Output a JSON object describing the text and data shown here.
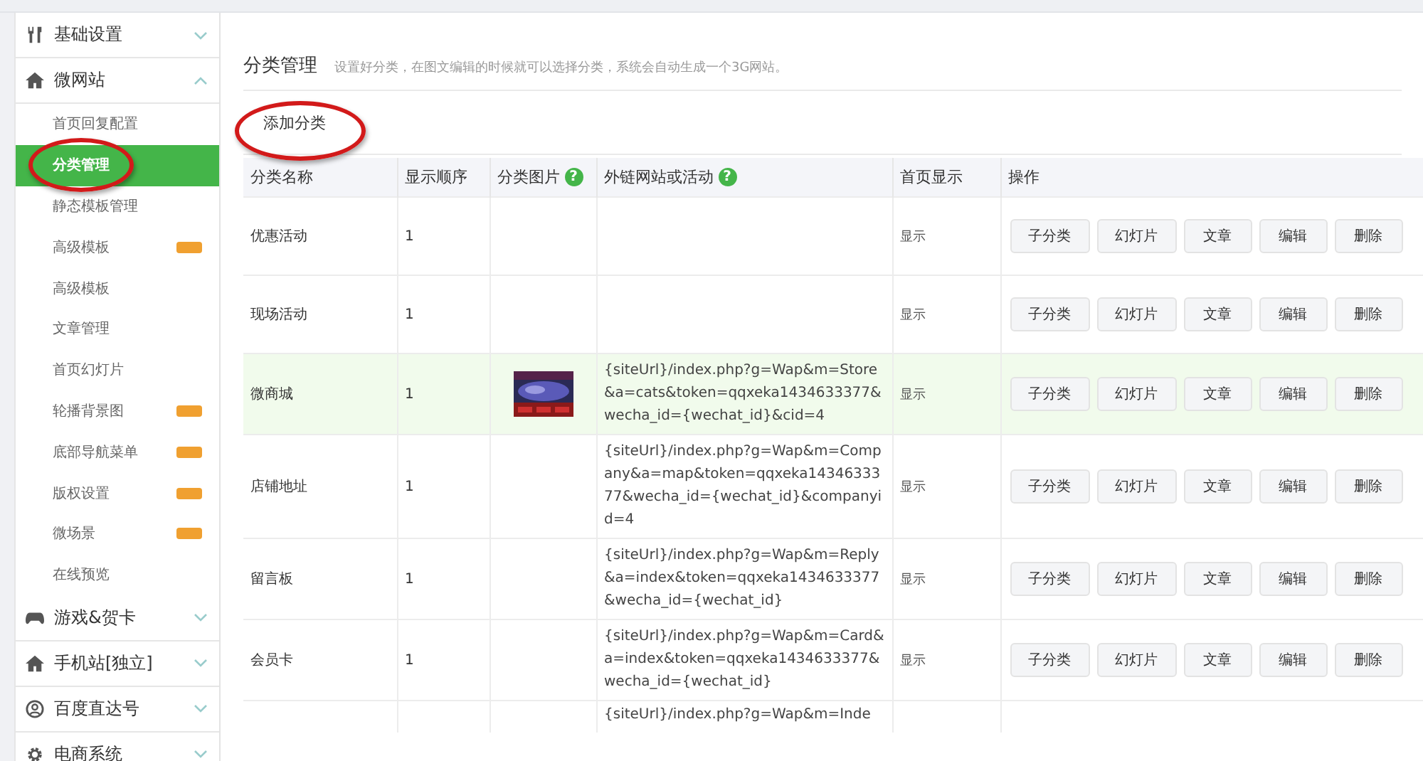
{
  "sidebar": {
    "groups": [
      {
        "label": "基础设置",
        "expanded": false
      },
      {
        "label": "微网站",
        "expanded": true,
        "items": [
          {
            "label": "首页回复配置",
            "selected": false,
            "new": false,
            "circled": false
          },
          {
            "label": "分类管理",
            "selected": true,
            "new": false,
            "circled": true
          },
          {
            "label": "静态模板管理",
            "selected": false,
            "new": false,
            "circled": false
          },
          {
            "label": "高级模板",
            "selected": false,
            "new": true,
            "circled": false
          },
          {
            "label": "高级模板",
            "selected": false,
            "new": false,
            "circled": false
          },
          {
            "label": "文章管理",
            "selected": false,
            "new": false,
            "circled": false
          },
          {
            "label": "首页幻灯片",
            "selected": false,
            "new": false,
            "circled": false
          },
          {
            "label": "轮播背景图",
            "selected": false,
            "new": true,
            "circled": false
          },
          {
            "label": "底部导航菜单",
            "selected": false,
            "new": true,
            "circled": false
          },
          {
            "label": "版权设置",
            "selected": false,
            "new": true,
            "circled": false
          },
          {
            "label": "微场景",
            "selected": false,
            "new": true,
            "circled": false
          },
          {
            "label": "在线预览",
            "selected": false,
            "new": false,
            "circled": false
          }
        ]
      },
      {
        "label": "游戏&贺卡",
        "expanded": false
      },
      {
        "label": "手机站[独立]",
        "expanded": false
      },
      {
        "label": "百度直达号",
        "expanded": false
      },
      {
        "label": "电商系统",
        "expanded": false
      }
    ]
  },
  "page": {
    "title": "分类管理",
    "subtitle": "设置好分类，在图文编辑的时候就可以选择分类，系统会自动生成一个3G网站。",
    "add_button": {
      "label": "添加分类",
      "circled": true
    }
  },
  "table": {
    "columns": [
      {
        "label": "分类名称",
        "help": false
      },
      {
        "label": "显示顺序",
        "help": false
      },
      {
        "label": "分类图片",
        "help": true
      },
      {
        "label": "外链网站或活动",
        "help": true
      },
      {
        "label": "首页显示",
        "help": false
      },
      {
        "label": "操作",
        "help": false
      }
    ],
    "help_mark": "?",
    "rows": [
      {
        "name": "优惠活动",
        "order": "1",
        "home": "显示",
        "selected": false,
        "actions": [
          "子分类",
          "幻灯片",
          "文章",
          "编辑",
          "删除"
        ]
      },
      {
        "name": "现场活动",
        "order": "1",
        "home": "显示",
        "selected": false,
        "actions": [
          "子分类",
          "幻灯片",
          "文章",
          "编辑",
          "删除"
        ]
      },
      {
        "name": "微商城",
        "order": "1",
        "image": {
          "kind": "picture"
        },
        "link": "{siteUrl}/index.php?g=Wap&m=Store&a=cats&token=qqxeka1434633377&wecha_id={wechat_id}&cid=4",
        "home": "显示",
        "selected": true,
        "actions": [
          "子分类",
          "幻灯片",
          "文章",
          "编辑",
          "删除"
        ]
      },
      {
        "name": "店铺地址",
        "order": "1",
        "link": "{siteUrl}/index.php?g=Wap&m=Company&a=map&token=qqxeka1434633377&wecha_id={wechat_id}&companyid=4",
        "home": "显示",
        "selected": false,
        "actions": [
          "子分类",
          "幻灯片",
          "文章",
          "编辑",
          "删除"
        ]
      },
      {
        "name": "留言板",
        "order": "1",
        "link": "{siteUrl}/index.php?g=Wap&m=Reply&a=index&token=qqxeka1434633377&wecha_id={wechat_id}",
        "home": "显示",
        "selected": false,
        "actions": [
          "子分类",
          "幻灯片",
          "文章",
          "编辑",
          "删除"
        ]
      },
      {
        "name": "会员卡",
        "order": "1",
        "link": "{siteUrl}/index.php?g=Wap&m=Card&a=index&token=qqxeka1434633377&wecha_id={wechat_id}",
        "home": "显示",
        "selected": false,
        "actions": [
          "子分类",
          "幻灯片",
          "文章",
          "编辑",
          "删除"
        ]
      },
      {
        "link": "{siteUrl}/index.php?g=Wap&m=Inde",
        "selected": false
      }
    ]
  }
}
